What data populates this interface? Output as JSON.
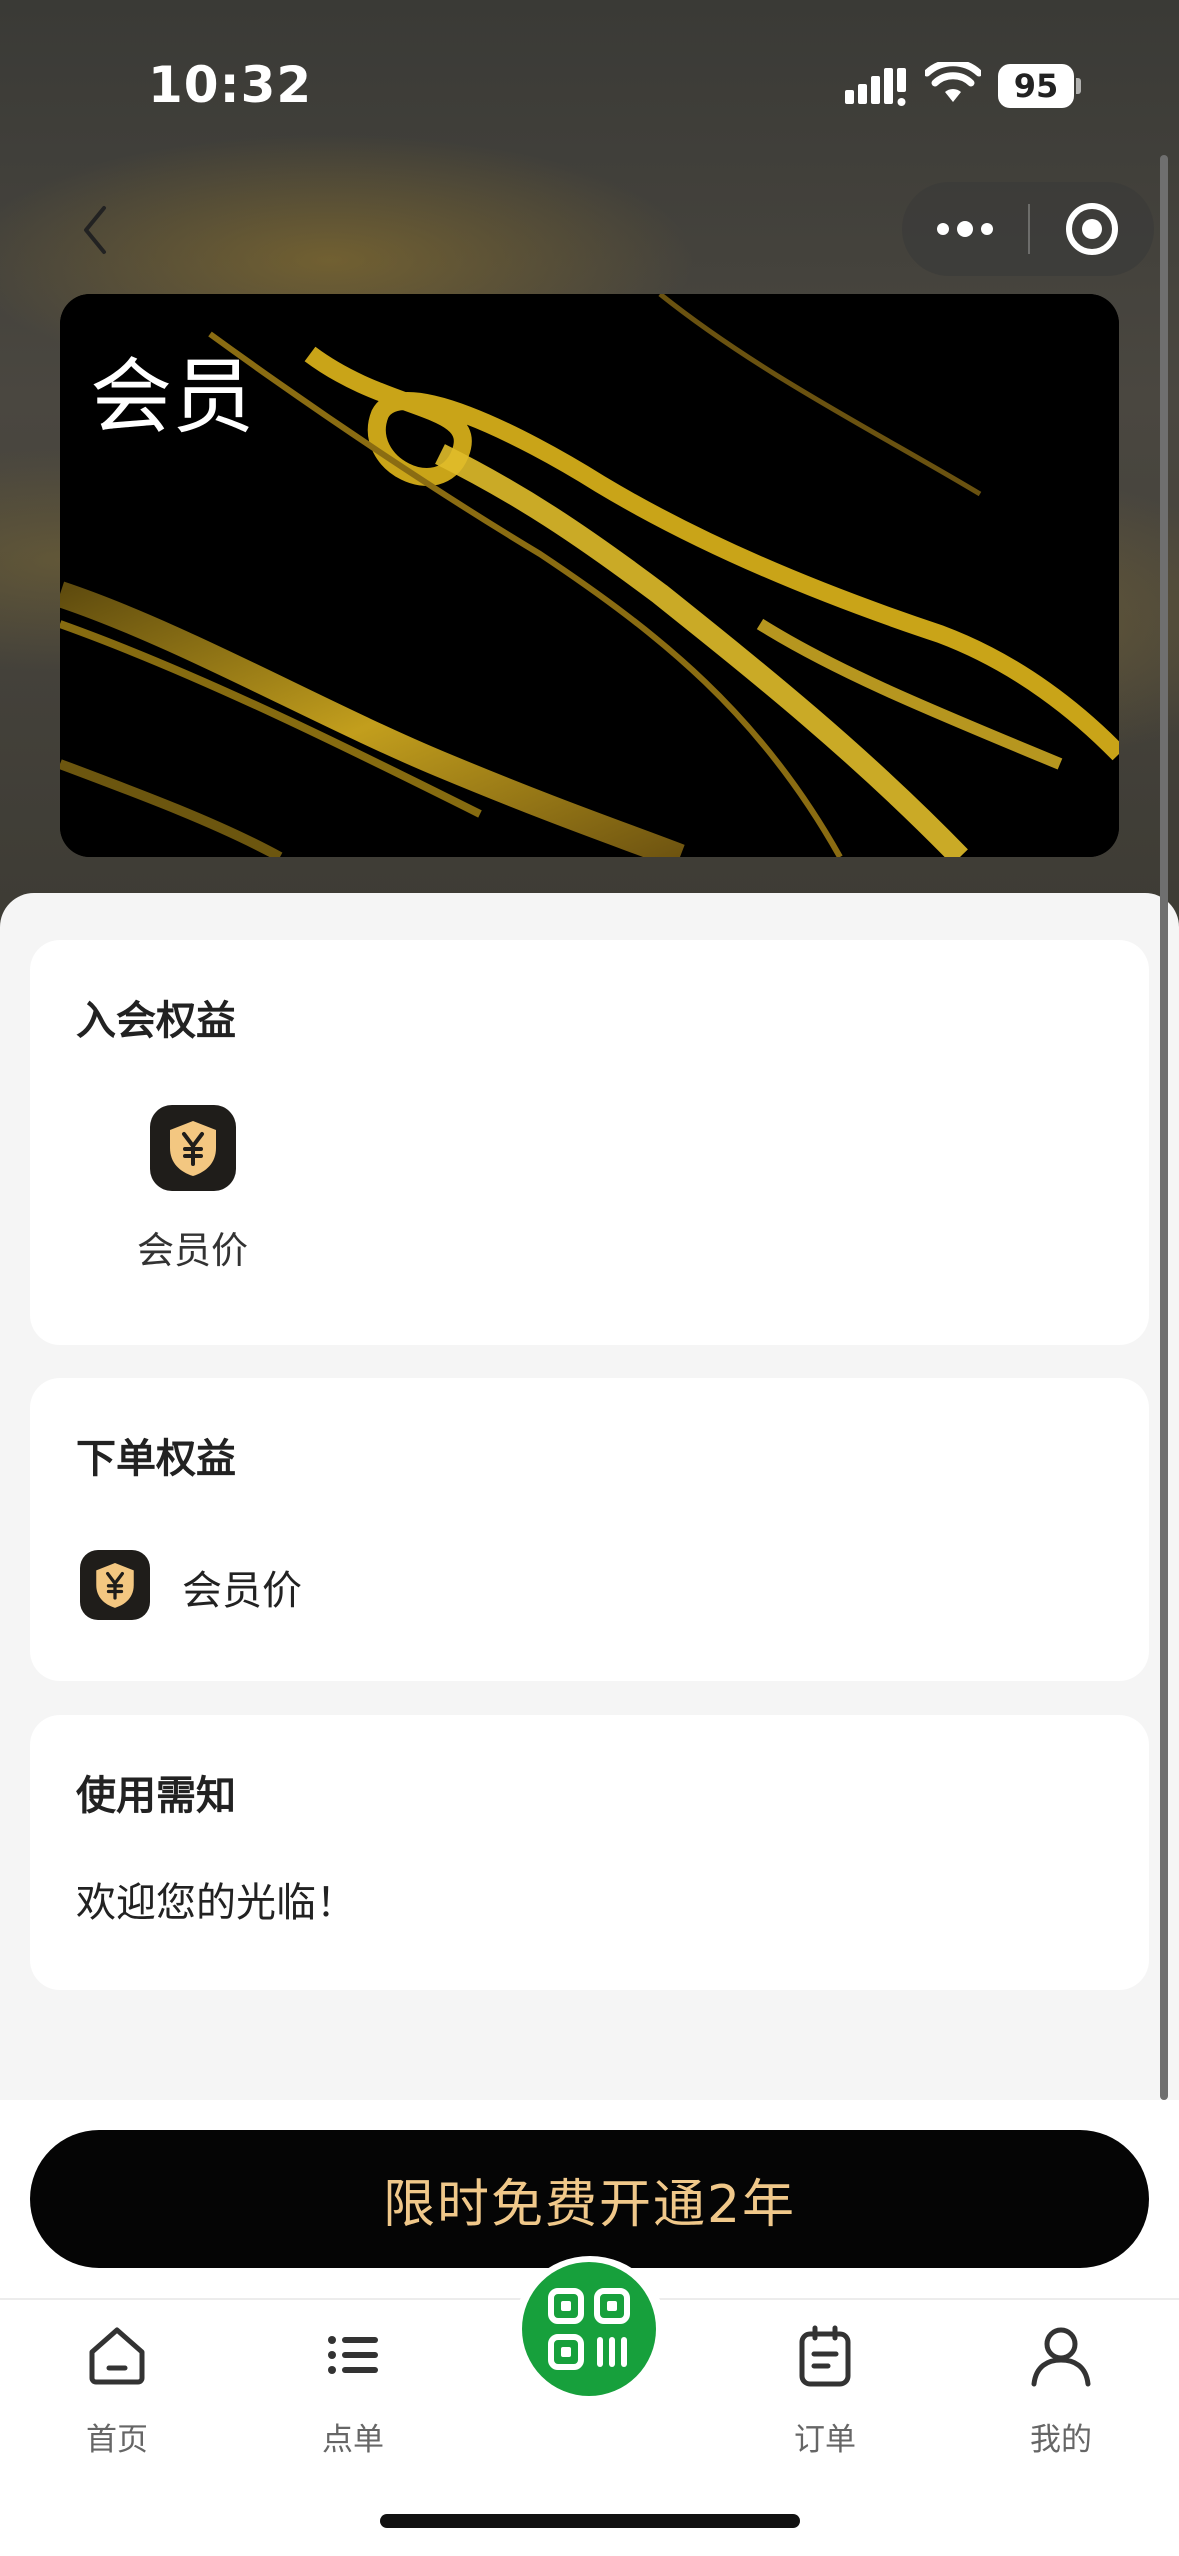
{
  "status_bar": {
    "time": "10:32",
    "battery": "95"
  },
  "nav": {
    "back_icon": "chevron-left-icon",
    "more_icon": "more-dots-icon",
    "target_icon": "target-icon"
  },
  "card": {
    "title": "会员"
  },
  "join_benefits": {
    "title": "入会权益",
    "items": [
      {
        "label": "会员价",
        "icon": "yuan-shield-icon"
      }
    ]
  },
  "order_benefits": {
    "title": "下单权益",
    "items": [
      {
        "label": "会员价",
        "icon": "yuan-shield-icon"
      }
    ]
  },
  "notice": {
    "title": "使用需知",
    "text": "欢迎您的光临！"
  },
  "cta": {
    "label": "限时免费开通2年"
  },
  "tabbar": {
    "items": [
      {
        "label": "首页",
        "icon": "home-icon"
      },
      {
        "label": "点单",
        "icon": "list-icon"
      },
      {
        "label": "",
        "icon": "qr-scan-icon"
      },
      {
        "label": "订单",
        "icon": "calendar-icon"
      },
      {
        "label": "我的",
        "icon": "user-icon"
      }
    ]
  },
  "colors": {
    "accent_gold": "#f0c88a",
    "scan_green": "#17a03c",
    "card_black": "#000000"
  }
}
